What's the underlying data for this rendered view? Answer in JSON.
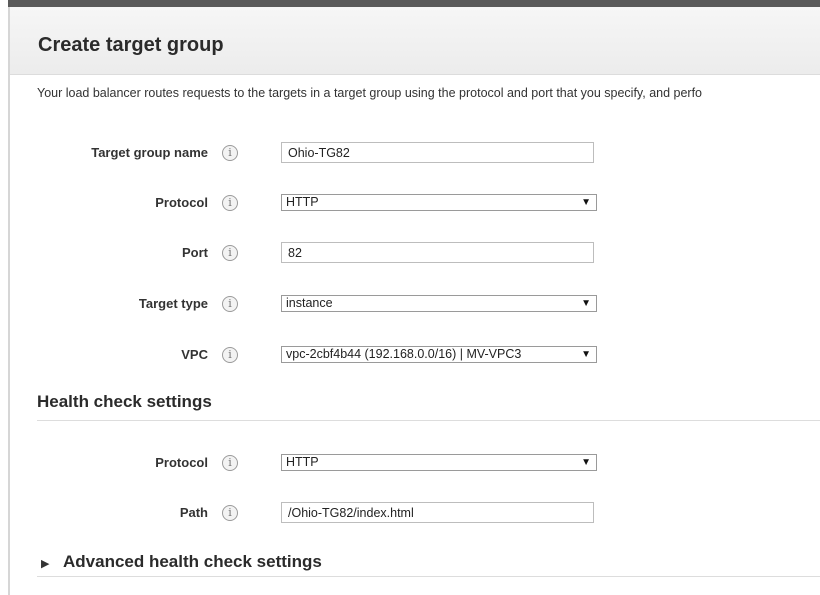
{
  "page": {
    "title": "Create target group",
    "description": "Your load balancer routes requests to the targets in a target group using the protocol and port that you specify, and perfo"
  },
  "fields": {
    "target_group_name": {
      "label": "Target group name",
      "value": "Ohio-TG82"
    },
    "protocol": {
      "label": "Protocol",
      "value": "HTTP"
    },
    "port": {
      "label": "Port",
      "value": "82"
    },
    "target_type": {
      "label": "Target type",
      "value": "instance"
    },
    "vpc": {
      "label": "VPC",
      "value": "vpc-2cbf4b44 (192.168.0.0/16) | MV-VPC3"
    }
  },
  "health_check": {
    "title": "Health check settings",
    "protocol": {
      "label": "Protocol",
      "value": "HTTP"
    },
    "path": {
      "label": "Path",
      "value": "/Ohio-TG82/index.html"
    }
  },
  "advanced": {
    "label": "Advanced health check settings"
  },
  "icons": {
    "info": "info-icon",
    "dropdown": "chevron-down-icon",
    "expand": "caret-right-icon"
  },
  "glyphs": {
    "info": "i",
    "caret": "▼",
    "expand": "▶"
  },
  "colors": {
    "header_bg": "#ececec",
    "top_bar": "#5a5a5a",
    "border": "#bdbdbd"
  }
}
